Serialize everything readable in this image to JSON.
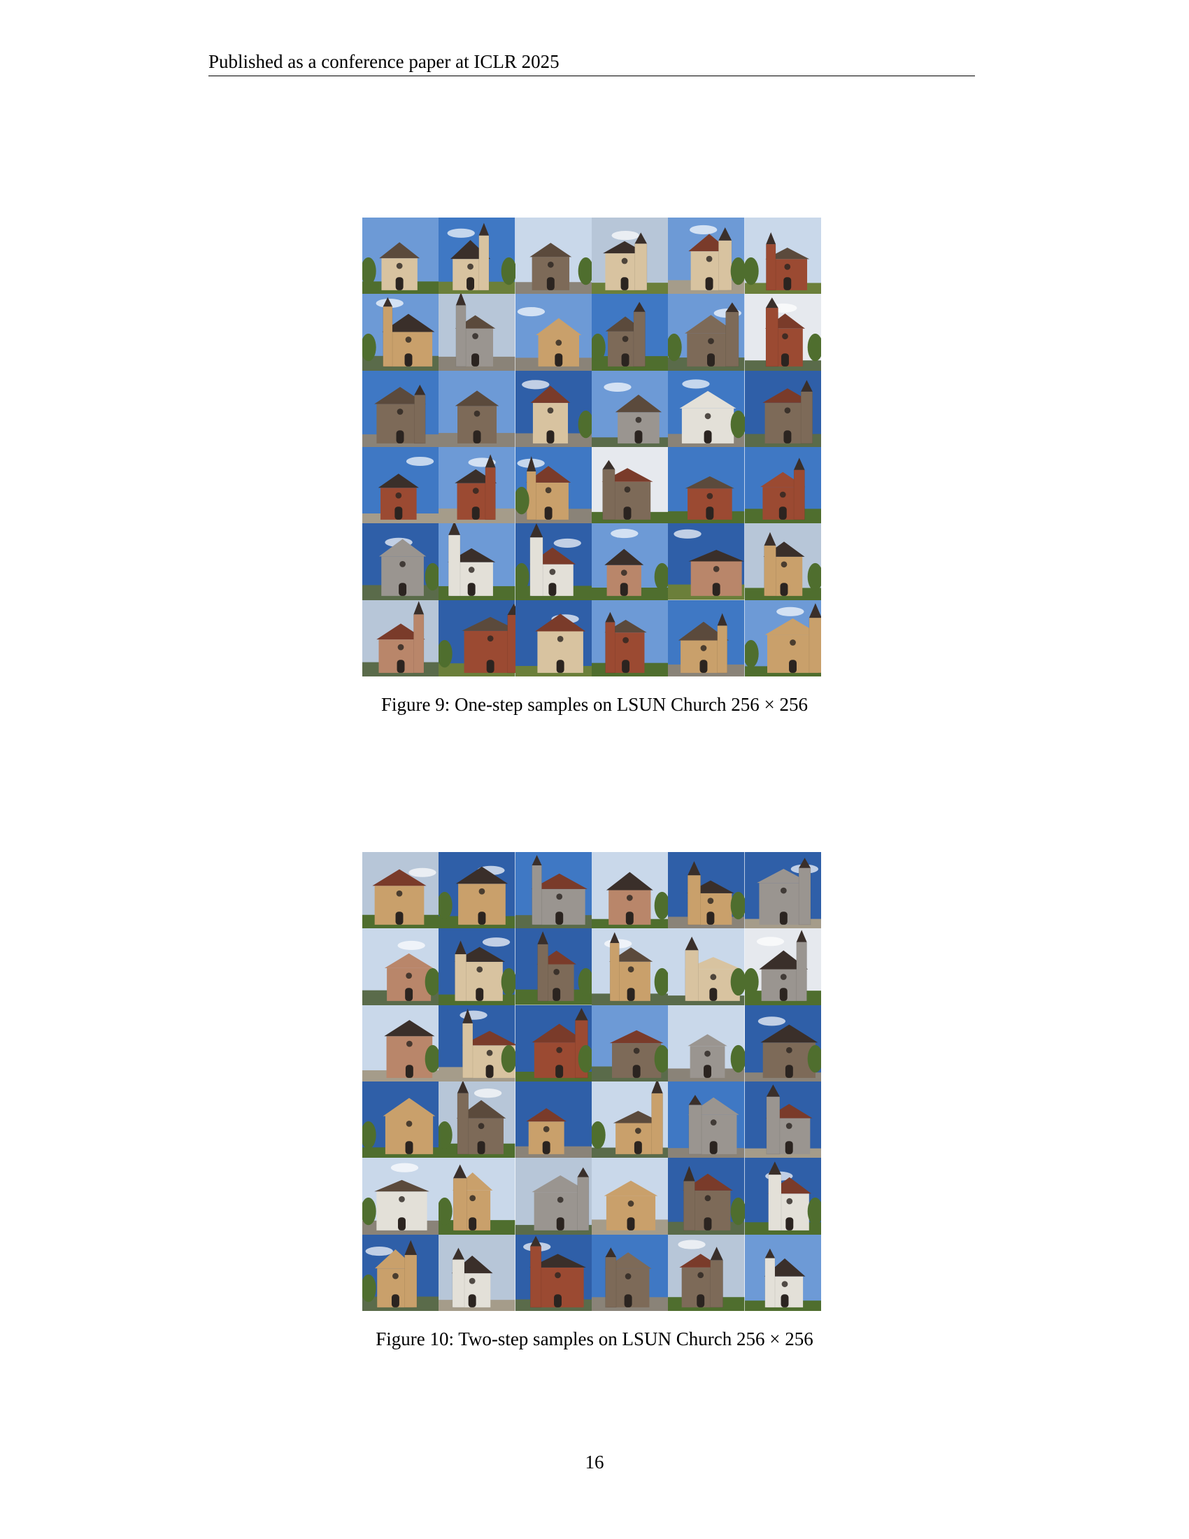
{
  "header": {
    "text": "Published as a conference paper at ICLR 2025"
  },
  "figures": [
    {
      "caption_prefix": "Figure 9:",
      "caption_text": "One-step samples on LSUN Church",
      "caption_math": "256 × 256",
      "image_description_icon": "church-sample-thumbnail",
      "rows": 6,
      "cols": 6
    },
    {
      "caption_prefix": "Figure 10:",
      "caption_text": "Two-step samples on LSUN Church",
      "caption_math": "256 × 256",
      "image_description_icon": "church-sample-thumbnail",
      "rows": 6,
      "cols": 6
    }
  ],
  "page_number": "16",
  "palette": {
    "sky_blue": "#3f78c4",
    "sky_pale": "#c9d8ea",
    "stone_warm": "#c9a06b",
    "stone_gray": "#9a9590",
    "brick": "#9b4a32",
    "foliage": "#4f6e2e",
    "dark": "#3a2f2a"
  }
}
